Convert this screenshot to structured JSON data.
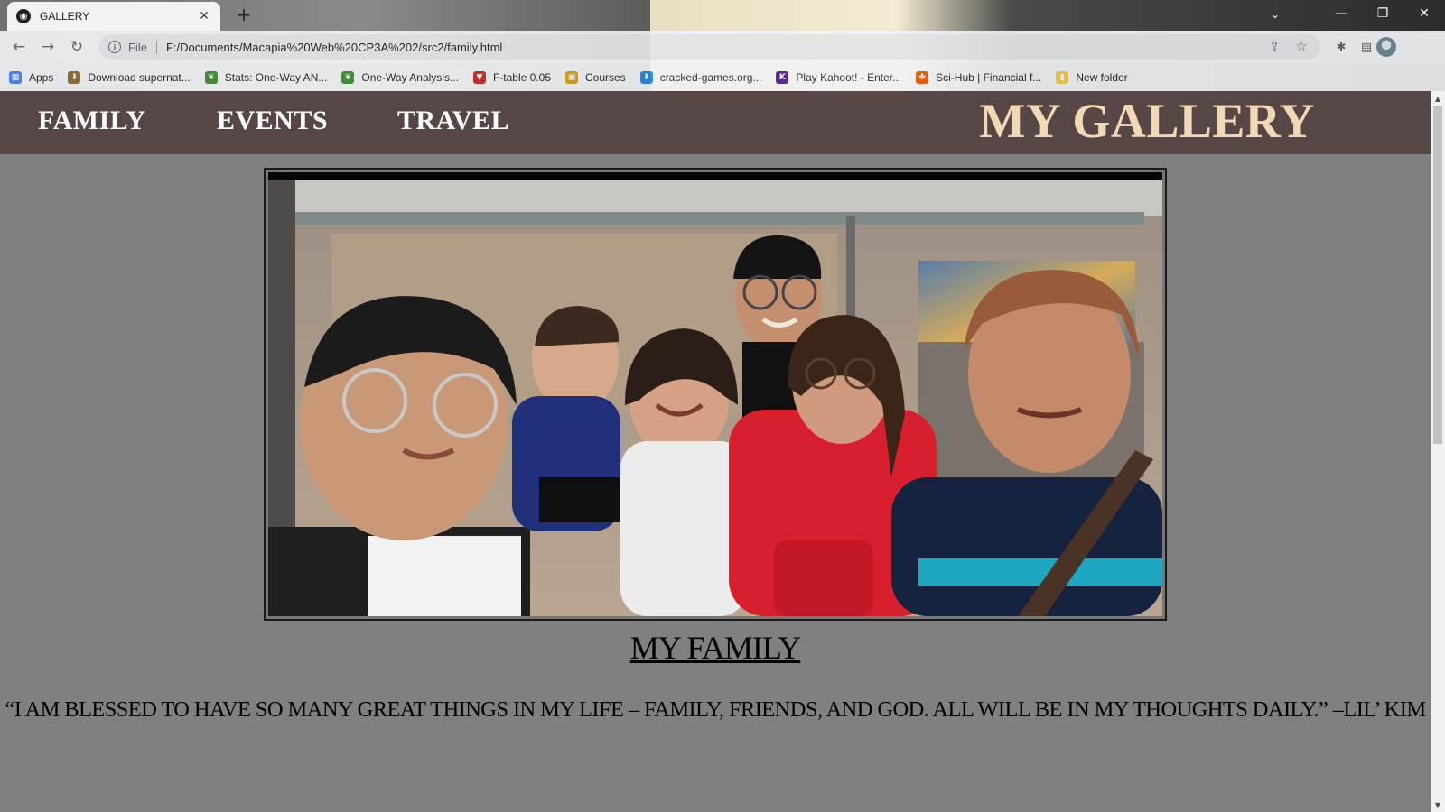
{
  "browser": {
    "tab_title": "GALLERY",
    "tab_close": "✕",
    "new_tab": "+",
    "window_controls": {
      "minimize": "—",
      "restore": "❐",
      "close": "✕"
    },
    "tab_search": "⌄",
    "nav": {
      "back": "←",
      "forward": "→",
      "reload": "↻"
    },
    "address": {
      "scheme_label": "File",
      "url": "F:/Documents/Macapia%20Web%20CP3A%202/src2/family.html"
    },
    "bookmarks": [
      {
        "label": "Apps",
        "icon": "apps-grid-icon",
        "color": "#4285f4"
      },
      {
        "label": "Download supernat...",
        "icon": "download-badge-icon",
        "color": "#8a6d2f"
      },
      {
        "label": "Stats: One-Way AN...",
        "icon": "leaf-icon",
        "color": "#3d8b2f"
      },
      {
        "label": "One-Way Analysis...",
        "icon": "leaf-icon",
        "color": "#3d8b2f"
      },
      {
        "label": "F-table 0.05",
        "icon": "shield-logo-icon",
        "color": "#c62828"
      },
      {
        "label": "Courses",
        "icon": "courses-icon",
        "color": "#d4a017"
      },
      {
        "label": "cracked-games.org...",
        "icon": "download-arrow-icon",
        "color": "#1e88e5"
      },
      {
        "label": "Play Kahoot! - Enter...",
        "icon": "kahoot-icon",
        "color": "#46178f"
      },
      {
        "label": "Sci-Hub | Financial f...",
        "icon": "raven-icon",
        "color": "#e65100"
      },
      {
        "label": "New folder",
        "icon": "folder-icon",
        "color": "#f9c74f"
      }
    ]
  },
  "site": {
    "nav_links": [
      "FAMILY",
      "EVENTS",
      "TRAVEL"
    ],
    "brand": "MY GALLERY",
    "colors": {
      "nav_bg": "#574646",
      "brand": "#f2d9b6",
      "page_bg": "#808080"
    }
  },
  "content": {
    "photo_alt": "family-photo",
    "heading": "MY FAMILY",
    "quote": "“I AM BLESSED TO HAVE SO MANY GREAT THINGS IN MY LIFE – FAMILY, FRIENDS, AND GOD. ALL WILL BE IN MY THOUGHTS DAILY.” –LIL’ KIM"
  }
}
